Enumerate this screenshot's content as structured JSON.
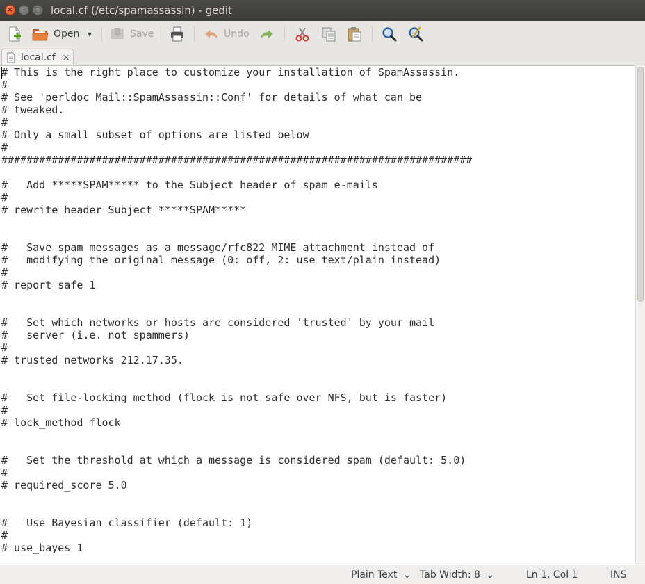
{
  "window": {
    "title": "local.cf (/etc/spamassassin) - gedit",
    "close_glyph": "×",
    "min_glyph": "–",
    "max_glyph": "□"
  },
  "toolbar": {
    "open_label": "Open",
    "save_label": "Save",
    "undo_label": "Undo",
    "icons": [
      "new-document-icon",
      "open-folder-icon",
      "dropdown-arrow-icon",
      "save-icon",
      "print-icon",
      "undo-icon",
      "redo-icon",
      "cut-icon",
      "copy-icon",
      "paste-icon",
      "find-icon",
      "find-replace-icon"
    ],
    "dropdown_glyph": "▾"
  },
  "tab": {
    "label": "local.cf",
    "close_glyph": "×"
  },
  "document": {
    "lines": [
      "# This is the right place to customize your installation of SpamAssassin.",
      "#",
      "# See 'perldoc Mail::SpamAssassin::Conf' for details of what can be",
      "# tweaked.",
      "#",
      "# Only a small subset of options are listed below",
      "#",
      "###########################################################################",
      "",
      "#   Add *****SPAM***** to the Subject header of spam e-mails",
      "#",
      "# rewrite_header Subject *****SPAM*****",
      "",
      "",
      "#   Save spam messages as a message/rfc822 MIME attachment instead of",
      "#   modifying the original message (0: off, 2: use text/plain instead)",
      "#",
      "# report_safe 1",
      "",
      "",
      "#   Set which networks or hosts are considered 'trusted' by your mail",
      "#   server (i.e. not spammers)",
      "#",
      "# trusted_networks 212.17.35.",
      "",
      "",
      "#   Set file-locking method (flock is not safe over NFS, but is faster)",
      "#",
      "# lock_method flock",
      "",
      "",
      "#   Set the threshold at which a message is considered spam (default: 5.0)",
      "#",
      "# required_score 5.0",
      "",
      "",
      "#   Use Bayesian classifier (default: 1)",
      "#",
      "# use_bayes 1"
    ]
  },
  "statusbar": {
    "language": "Plain Text",
    "tab_width": "Tab Width: 8",
    "position": "Ln 1, Col 1",
    "mode": "INS",
    "dropdown_glyph": "⌄"
  },
  "colors": {
    "titlebar": "#3c3b37",
    "close_button": "#df4a16",
    "undo_arrow": "#c87d4a",
    "redo_arrow": "#6a9a3a"
  }
}
